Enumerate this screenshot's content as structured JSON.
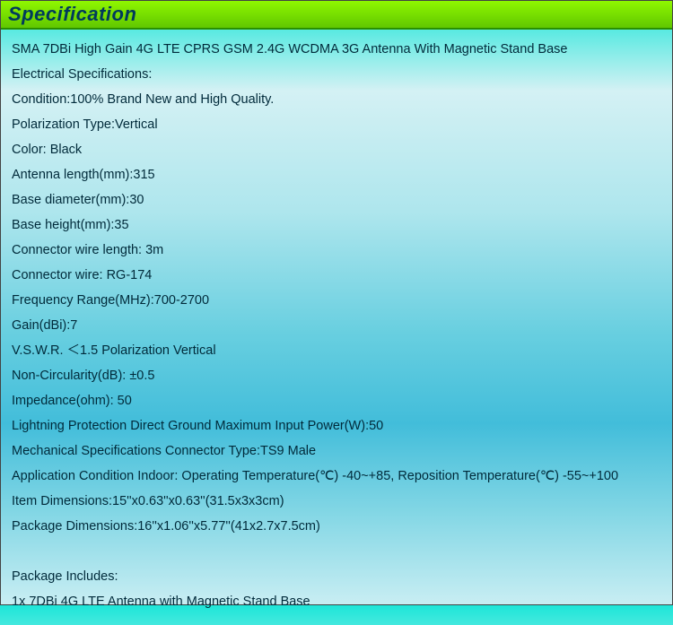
{
  "header": {
    "title": "Specification"
  },
  "lines": [
    "SMA 7DBi High Gain 4G LTE CPRS GSM 2.4G WCDMA 3G Antenna With Magnetic Stand Base",
    "Electrical Specifications:",
    "Condition:100% Brand New and High Quality.",
    "Polarization Type:Vertical",
    "Color: Black",
    "Antenna length(mm):315",
    "Base diameter(mm):30",
    "Base height(mm):35",
    "Connector wire length:  3m",
    "Connector wire:  RG-174",
    "Frequency Range(MHz):700-2700",
    "Gain(dBi):7",
    "V.S.W.R. ＜1.5 Polarization Vertical",
    "Non-Circularity(dB): ±0.5",
    "Impedance(ohm): 50",
    "Lightning Protection Direct Ground Maximum Input Power(W):50",
    "Mechanical Specifications Connector Type:TS9 Male",
    "Application Condition Indoor: Operating Temperature(℃) -40~+85, Reposition Temperature(℃) -55~+100",
    "Item Dimensions:15''x0.63''x0.63''(31.5x3x3cm)",
    "Package Dimensions:16''x1.06''x5.77''(41x2.7x7.5cm)",
    "",
    "Package Includes:",
    "1x 7DBi 4G LTE Antenna with Magnetic Stand Base"
  ]
}
